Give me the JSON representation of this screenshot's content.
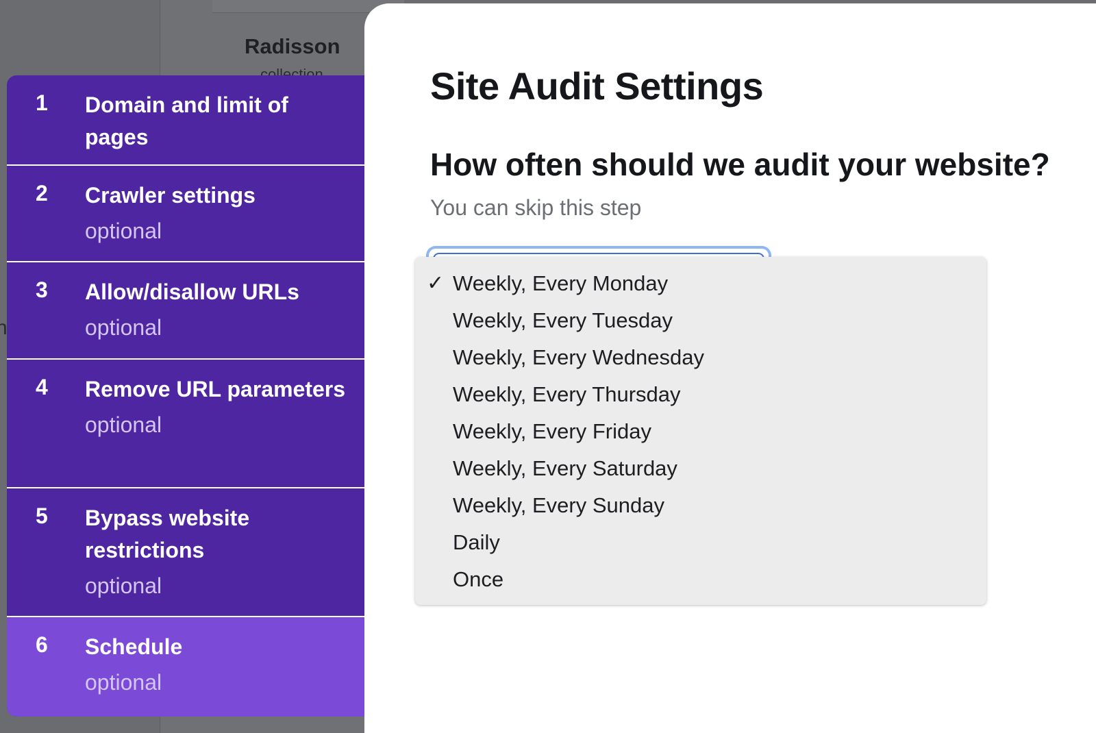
{
  "background": {
    "hotel_title": "Radisson",
    "hotel_subtitle": "collection"
  },
  "steps": [
    {
      "number": "1",
      "title": "Domain and limit of pages",
      "optional": ""
    },
    {
      "number": "2",
      "title": "Crawler settings",
      "optional": "optional"
    },
    {
      "number": "3",
      "title": "Allow/disallow URLs",
      "optional": "optional"
    },
    {
      "number": "4",
      "title": "Remove URL parameters",
      "optional": "optional"
    },
    {
      "number": "5",
      "title": "Bypass website restrictions",
      "optional": "optional"
    },
    {
      "number": "6",
      "title": "Schedule",
      "optional": "optional"
    }
  ],
  "active_step": "6",
  "panel": {
    "title": "Site Audit Settings",
    "question": "How often should we audit your website?",
    "hint": "You can skip this step"
  },
  "dropdown": {
    "check_glyph": "✓",
    "options": [
      "Weekly, Every Monday",
      "Weekly, Every Tuesday",
      "Weekly, Every Wednesday",
      "Weekly, Every Thursday",
      "Weekly, Every Friday",
      "Weekly, Every Saturday",
      "Weekly, Every Sunday",
      "Daily",
      "Once"
    ],
    "selected": "Weekly, Every Monday"
  },
  "colors": {
    "sidebar": "#4f26a1",
    "sidebar_active": "#7b4ad6",
    "focus_ring": "#8fb8f2"
  }
}
